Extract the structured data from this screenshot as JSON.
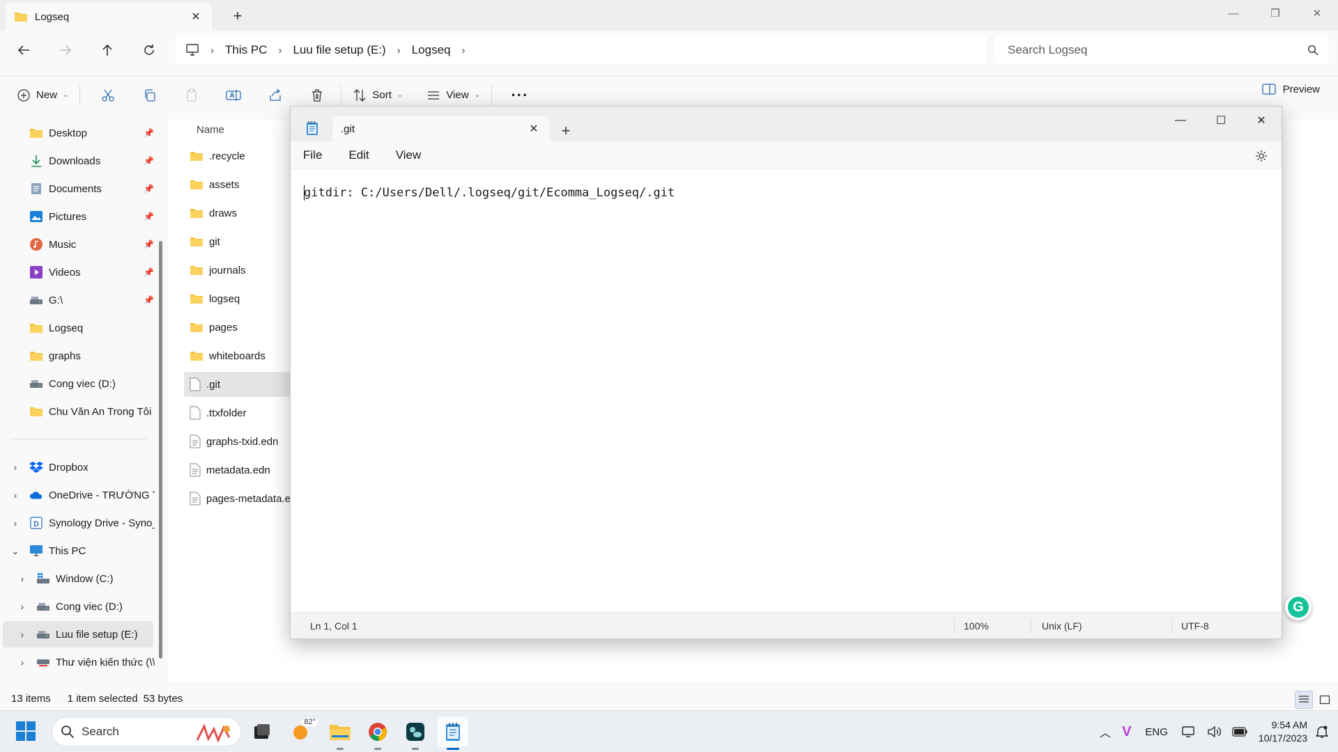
{
  "explorer": {
    "tab_title": "Logseq",
    "breadcrumb": [
      "This PC",
      "Luu file setup (E:)",
      "Logseq"
    ],
    "search_placeholder": "Search Logseq",
    "toolbar": {
      "new_label": "New",
      "sort_label": "Sort",
      "view_label": "View",
      "preview_label": "Preview"
    },
    "nav": {
      "quick_access": [
        {
          "label": "Desktop",
          "icon": "folder-blue-icon",
          "pinned": true
        },
        {
          "label": "Downloads",
          "icon": "download-icon",
          "pinned": true
        },
        {
          "label": "Documents",
          "icon": "document-icon",
          "pinned": true
        },
        {
          "label": "Pictures",
          "icon": "pictures-icon",
          "pinned": true
        },
        {
          "label": "Music",
          "icon": "music-icon",
          "pinned": true
        },
        {
          "label": "Videos",
          "icon": "videos-icon",
          "pinned": true
        },
        {
          "label": "G:\\",
          "icon": "drive-icon",
          "pinned": true
        },
        {
          "label": "Logseq",
          "icon": "folder-icon",
          "pinned": false
        },
        {
          "label": "graphs",
          "icon": "folder-icon",
          "pinned": false
        },
        {
          "label": "Cong viec (D:)",
          "icon": "drive-icon",
          "pinned": false
        },
        {
          "label": "Chu Văn An Trong Tôi",
          "icon": "folder-icon",
          "pinned": false
        }
      ],
      "tree": [
        {
          "label": "Dropbox",
          "icon": "dropbox-icon"
        },
        {
          "label": "OneDrive - TRƯỜNG TH",
          "icon": "onedrive-icon"
        },
        {
          "label": "Synology Drive - Syno_",
          "icon": "synology-icon"
        },
        {
          "label": "This PC",
          "icon": "computer-icon"
        },
        {
          "label": "Window (C:)",
          "icon": "windows-drive-icon"
        },
        {
          "label": "Cong viec (D:)",
          "icon": "drive-icon"
        },
        {
          "label": "Luu file setup (E:)",
          "icon": "drive-icon"
        },
        {
          "label": "Thư viện kiến thức (\\\\",
          "icon": "network-drive-icon"
        }
      ]
    },
    "column_header": "Name",
    "files": [
      {
        "name": ".recycle",
        "type": "folder"
      },
      {
        "name": "assets",
        "type": "folder"
      },
      {
        "name": "draws",
        "type": "folder"
      },
      {
        "name": "git",
        "type": "folder"
      },
      {
        "name": "journals",
        "type": "folder"
      },
      {
        "name": "logseq",
        "type": "folder"
      },
      {
        "name": "pages",
        "type": "folder"
      },
      {
        "name": "whiteboards",
        "type": "folder"
      },
      {
        "name": ".git",
        "type": "file",
        "selected": true
      },
      {
        "name": ".ttxfolder",
        "type": "file"
      },
      {
        "name": "graphs-txid.edn",
        "type": "text"
      },
      {
        "name": "metadata.edn",
        "type": "text"
      },
      {
        "name": "pages-metadata.e",
        "type": "text"
      }
    ],
    "status": {
      "items": "13 items",
      "selected": "1 item selected",
      "size": "53 bytes"
    }
  },
  "notepad": {
    "tab_title": ".git",
    "menus": [
      "File",
      "Edit",
      "View"
    ],
    "content": "gitdir: C:/Users/Dell/.logseq/git/Ecomma_Logseq/.git",
    "status": {
      "position": "Ln 1, Col 1",
      "zoom": "100%",
      "line_ending": "Unix (LF)",
      "encoding": "UTF-8"
    }
  },
  "taskbar": {
    "search_label": "Search",
    "weather_temp": "82°",
    "language": "ENG",
    "time": "9:54 AM",
    "date": "10/17/2023"
  },
  "colors": {
    "accent": "#0067c0",
    "folder": "#f6c342",
    "selection": "#e5e5e5"
  }
}
